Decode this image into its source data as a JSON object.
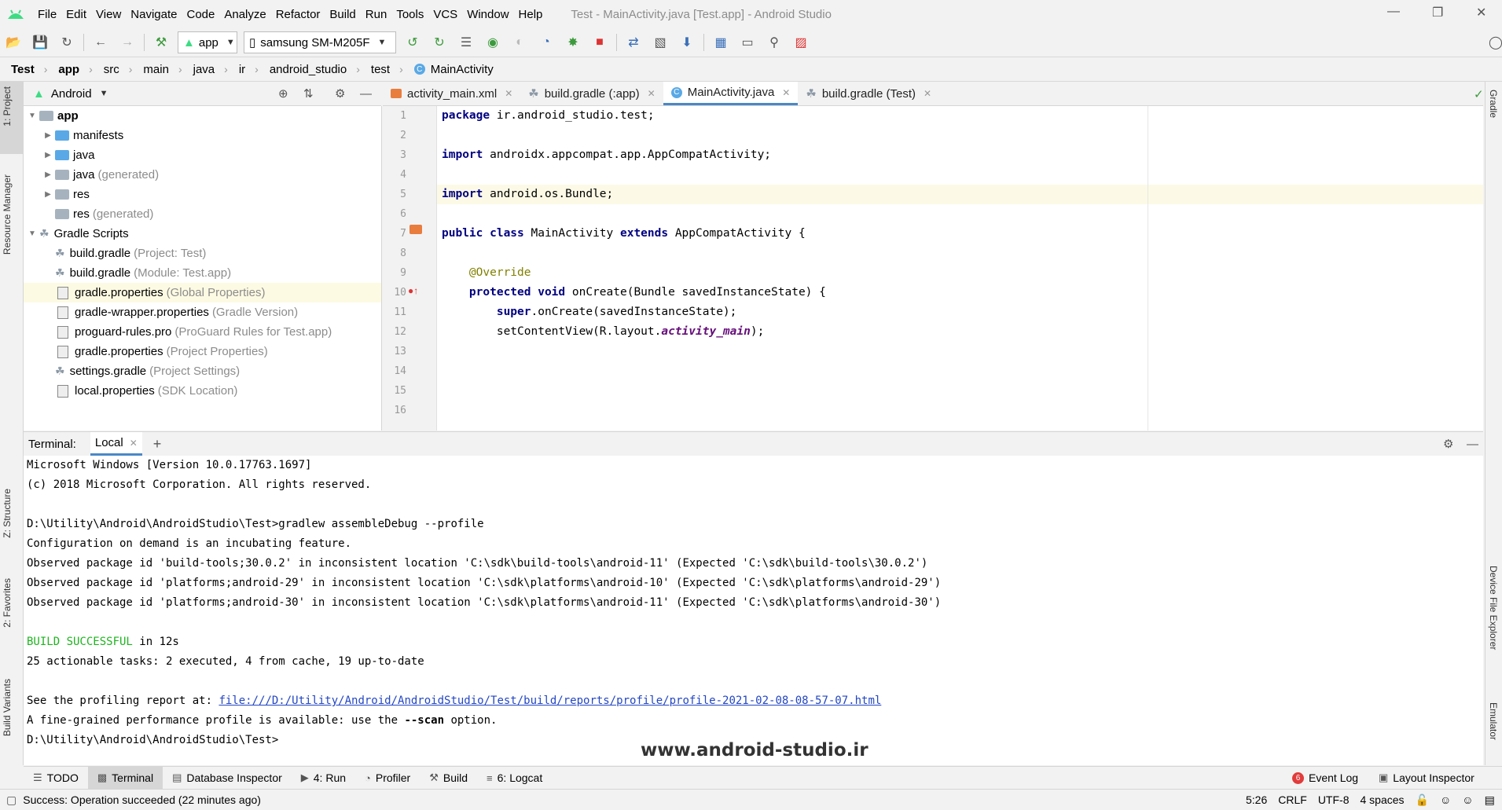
{
  "window": {
    "title": "Test - MainActivity.java [Test.app] - Android Studio"
  },
  "menu": [
    "File",
    "Edit",
    "View",
    "Navigate",
    "Code",
    "Analyze",
    "Refactor",
    "Build",
    "Run",
    "Tools",
    "VCS",
    "Window",
    "Help"
  ],
  "toolbar": {
    "run_config": "app",
    "device": "samsung SM-M205F"
  },
  "breadcrumb": [
    "Test",
    "app",
    "src",
    "main",
    "java",
    "ir",
    "android_studio",
    "test",
    "MainActivity"
  ],
  "left_stripe": [
    "1: Project",
    "Resource Manager",
    "Z: Structure",
    "2: Favorites",
    "Build Variants"
  ],
  "right_stripe": [
    "Gradle",
    "Device File Explorer",
    "Emulator"
  ],
  "project": {
    "view": "Android",
    "tree": [
      {
        "label": "app",
        "hint": ""
      },
      {
        "label": "manifests",
        "hint": ""
      },
      {
        "label": "java",
        "hint": ""
      },
      {
        "label": "java",
        "hint": "(generated)"
      },
      {
        "label": "res",
        "hint": ""
      },
      {
        "label": "res",
        "hint": "(generated)"
      },
      {
        "label": "Gradle Scripts",
        "hint": ""
      },
      {
        "label": "build.gradle",
        "hint": "(Project: Test)"
      },
      {
        "label": "build.gradle",
        "hint": "(Module: Test.app)"
      },
      {
        "label": "gradle.properties",
        "hint": "(Global Properties)"
      },
      {
        "label": "gradle-wrapper.properties",
        "hint": "(Gradle Version)"
      },
      {
        "label": "proguard-rules.pro",
        "hint": "(ProGuard Rules for Test.app)"
      },
      {
        "label": "gradle.properties",
        "hint": "(Project Properties)"
      },
      {
        "label": "settings.gradle",
        "hint": "(Project Settings)"
      },
      {
        "label": "local.properties",
        "hint": "(SDK Location)"
      }
    ]
  },
  "editor": {
    "tabs": [
      "activity_main.xml",
      "build.gradle (:app)",
      "MainActivity.java",
      "build.gradle (Test)"
    ],
    "line_numbers": [
      "1",
      "2",
      "3",
      "4",
      "5",
      "6",
      "7",
      "8",
      "9",
      "10",
      "11",
      "12",
      "13",
      "14",
      "15",
      "16"
    ],
    "code": {
      "l1_kw": "package",
      "l1_rest": " ir.android_studio.test;",
      "l3_kw": "import",
      "l3_rest": " androidx.appcompat.app.AppCompatActivity;",
      "l5_kw": "import",
      "l5_rest": " android.os.Bundle;",
      "l7_kw1": "public class",
      "l7_mid": " MainActivity ",
      "l7_kw2": "extends",
      "l7_rest": " AppCompatActivity {",
      "l9_anno": "@Override",
      "l10_kw": "protected void",
      "l10_rest": " onCreate(Bundle savedInstanceState) {",
      "l11_kw": "super",
      "l11_rest": ".onCreate(savedInstanceState);",
      "l12_pre": "setContentView(R.layout.",
      "l12_it": "activity_main",
      "l12_post": ");"
    }
  },
  "terminal": {
    "label": "Terminal:",
    "tab": "Local",
    "lines": {
      "l1": "Microsoft Windows [Version 10.0.17763.1697]",
      "l2": "(c) 2018 Microsoft Corporation. All rights reserved.",
      "l3": "D:\\Utility\\Android\\AndroidStudio\\Test>gradlew assembleDebug --profile",
      "l4": "Configuration on demand is an incubating feature.",
      "l5": "Observed package id 'build-tools;30.0.2' in inconsistent location 'C:\\sdk\\build-tools\\android-11' (Expected 'C:\\sdk\\build-tools\\30.0.2')",
      "l6": "Observed package id 'platforms;android-29' in inconsistent location 'C:\\sdk\\platforms\\android-10' (Expected 'C:\\sdk\\platforms\\android-29')",
      "l7": "Observed package id 'platforms;android-30' in inconsistent location 'C:\\sdk\\platforms\\android-11' (Expected 'C:\\sdk\\platforms\\android-30')",
      "build_ok": "BUILD SUCCESSFUL",
      "build_time": " in 12s",
      "tasks": "25 actionable tasks: 2 executed, 4 from cache, 19 up-to-date",
      "report_prefix": "See the profiling report at: ",
      "report_link": "file:///D:/Utility/Android/AndroidStudio/Test/build/reports/profile/profile-2021-02-08-08-57-07.html",
      "perf_pre": "A fine-grained performance profile is available: use the ",
      "perf_flag": "--scan",
      "perf_post": " option.",
      "prompt": "D:\\Utility\\Android\\AndroidStudio\\Test>"
    }
  },
  "watermark": "www.android-studio.ir",
  "tool_windows": {
    "todo": "TODO",
    "terminal": "Terminal",
    "database": "Database Inspector",
    "run": "4: Run",
    "profiler": "Profiler",
    "build": "Build",
    "logcat": "6: Logcat",
    "event_log_count": "6",
    "event_log": "Event Log",
    "layout_inspector": "Layout Inspector"
  },
  "status": {
    "message": "Success: Operation succeeded (22 minutes ago)",
    "position": "5:26",
    "line_sep": "CRLF",
    "encoding": "UTF-8",
    "indent": "4 spaces"
  }
}
